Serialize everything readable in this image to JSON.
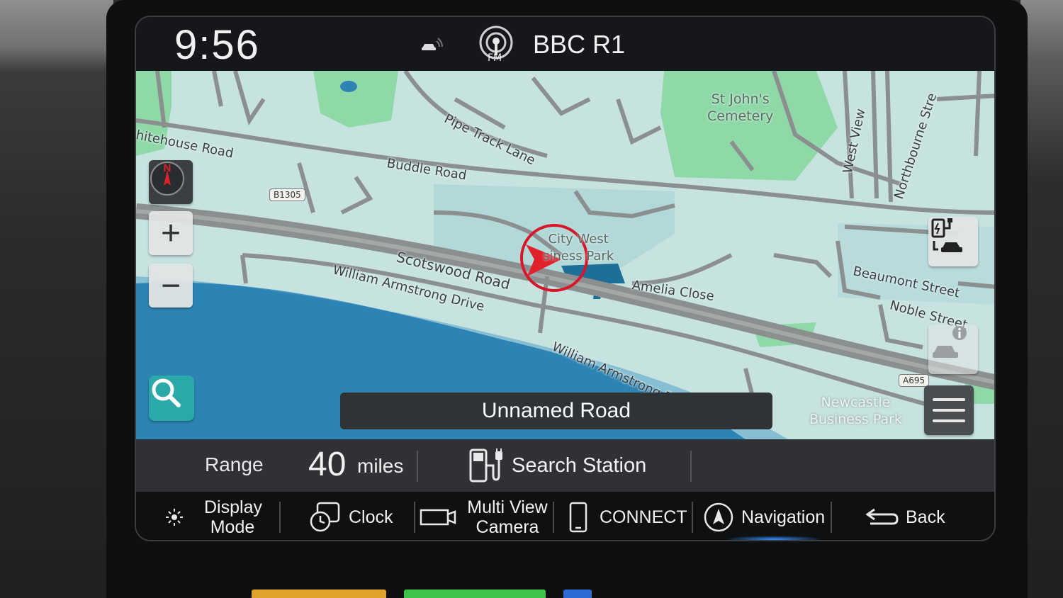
{
  "status_bar": {
    "time": "9:56",
    "station": "BBC R1",
    "fm_icon_label": "FM",
    "icons": [
      "car-link-icon",
      "fm-radio-icon"
    ]
  },
  "map": {
    "road_names": [
      "hitehouse Road",
      "Buddle Road",
      "Pipe Track Lane",
      "Scotswood Road",
      "William Armstrong Drive",
      "Amelia Close",
      "William Armstrong Drive",
      "Beaumont Street",
      "Noble Street",
      "West View",
      "Northbourne Stre"
    ],
    "places": {
      "cemetery": [
        "St John's",
        "Cemetery"
      ],
      "city_west": [
        "City West",
        "siness Park"
      ],
      "newcastle": [
        "Newcastle",
        "Business Park"
      ]
    },
    "shields": [
      "B1305",
      "A695"
    ],
    "current_road": "Unnamed Road",
    "compass_letter": "N",
    "controls": [
      "compass-icon",
      "zoom-in-icon",
      "zoom-out-icon",
      "search-icon",
      "ev-charging-icon",
      "info-icon",
      "menu-icon"
    ],
    "zoom_in_symbol": "+",
    "zoom_out_symbol": "−"
  },
  "range_bar": {
    "range_label": "Range",
    "range_value": "40",
    "range_unit": "miles",
    "search_station_label": "Search Station"
  },
  "bottom_nav": {
    "display_mode": "Display Mode",
    "clock": "Clock",
    "multi_view_camera": "Multi View Camera",
    "connect": "CONNECT",
    "navigation": "Navigation",
    "back": "Back",
    "active": "Navigation"
  },
  "colors": {
    "map_land": "#c7e3e0",
    "park_green": "#8fd9a8",
    "river_blue": "#2d84b4",
    "road_grey": "#8c8f8f",
    "search_teal": "#2aa9a8",
    "nav_pointer_red": "#e0202a",
    "active_glow": "#2e8cff"
  }
}
